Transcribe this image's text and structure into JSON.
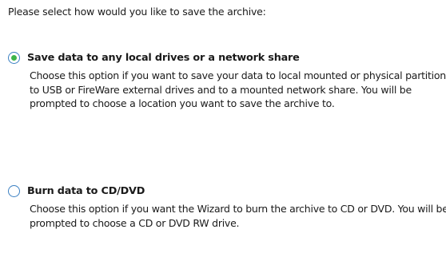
{
  "prompt": "Please select how would you like to save the archive:",
  "options": [
    {
      "label": "Save data to any local drives or a network share",
      "selected": true,
      "description": "Choose this option if you want to save your data to local mounted or physical partition, to USB or FireWare external drives and to a mounted network share. You will be prompted to choose a location you want to save the archive to."
    },
    {
      "label": "Burn data to CD/DVD",
      "selected": false,
      "description": "Choose this option if you want the Wizard to burn the archive to CD or DVD. You will be prompted to choose a CD or DVD RW drive."
    }
  ],
  "colors": {
    "radio_border": "#3a7fc2",
    "radio_dot": "#3db54a"
  }
}
